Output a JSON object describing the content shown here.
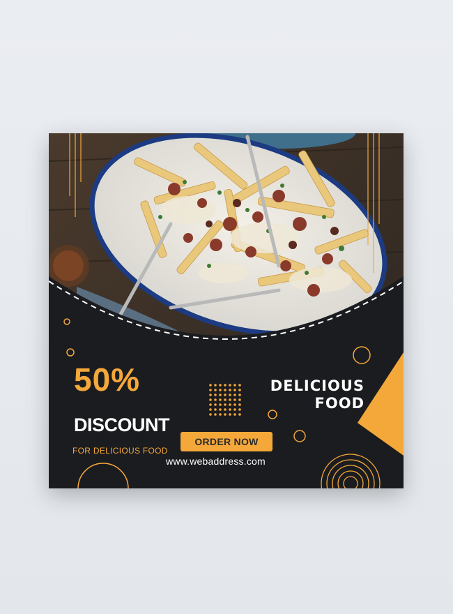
{
  "promo": {
    "percent": "50%",
    "discount": "DISCOUNT",
    "subtitle": "FOR DELICIOUS FOOD",
    "headline_line1": "DELICIOUS",
    "headline_line2": "FOOD",
    "order_button": "ORDER NOW",
    "website": "www.webaddress.com"
  },
  "colors": {
    "accent": "#f4a83a",
    "background": "#1b1c1f",
    "text": "#ffffff"
  }
}
